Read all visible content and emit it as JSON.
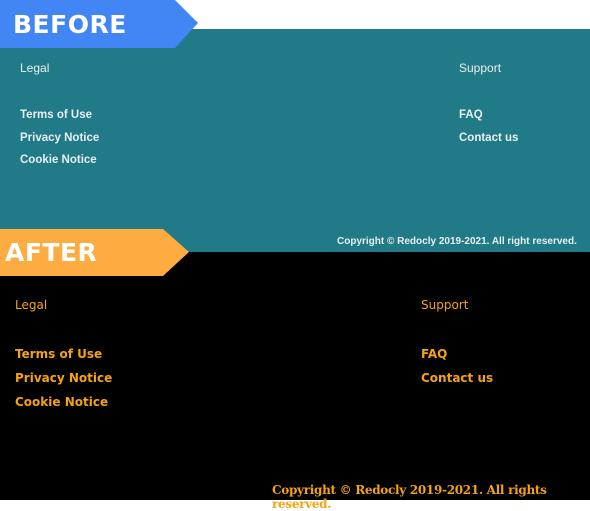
{
  "before": {
    "banner_label": "BEFORE",
    "legal": {
      "heading": "Legal",
      "links": [
        "Terms of Use",
        "Privacy Notice",
        "Cookie Notice"
      ]
    },
    "support": {
      "heading": "Support",
      "links": [
        "FAQ",
        "Contact us"
      ]
    },
    "copyright": "Copyright © Redocly 2019-2021. All right reserved.",
    "colors": {
      "banner": "#4285f4",
      "background": "#217a87",
      "text": "#e8f0f1"
    }
  },
  "after": {
    "banner_label": "AFTER",
    "legal": {
      "heading": "Legal",
      "links": [
        "Terms of Use",
        "Privacy Notice",
        "Cookie Notice"
      ]
    },
    "support": {
      "heading": "Support",
      "links": [
        "FAQ",
        "Contact us"
      ]
    },
    "copyright": "Copyright © Redocly 2019-2021. All rights reserved.",
    "colors": {
      "banner": "#fdac41",
      "background": "#000000",
      "text": "#f5a30f"
    }
  }
}
